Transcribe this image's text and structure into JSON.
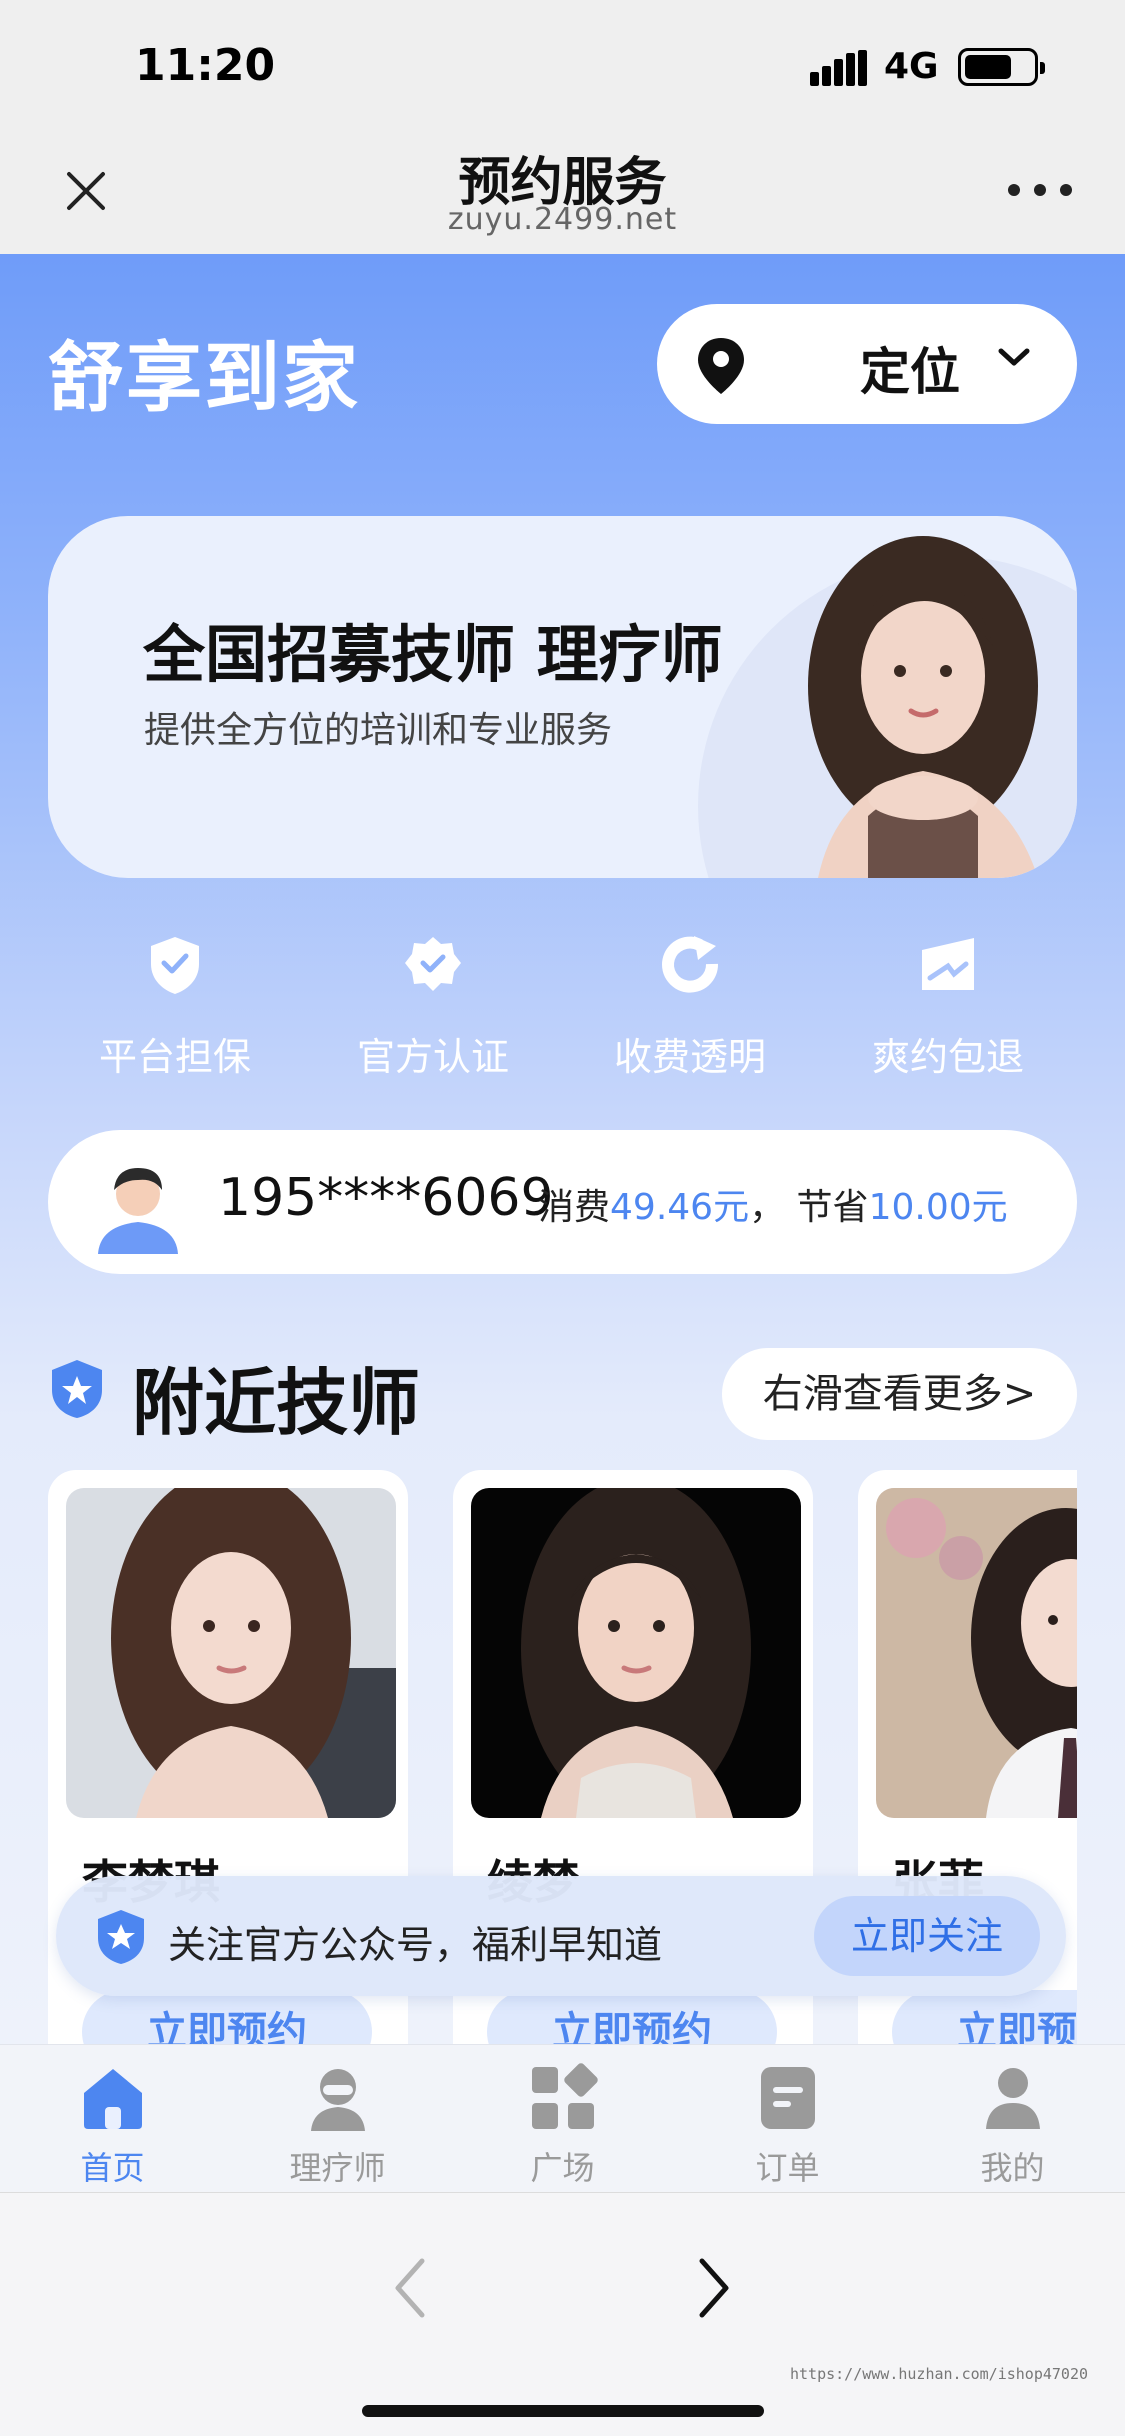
{
  "status_bar": {
    "time": "11:20",
    "network": "4G"
  },
  "browser": {
    "title": "预约服务",
    "url": "zuyu.2499.net"
  },
  "header": {
    "brand": "舒享到家",
    "locate_label": "定位"
  },
  "banner": {
    "title": "全国招募技师 理疗师",
    "subtitle": "提供全方位的培训和专业服务"
  },
  "features": [
    {
      "label": "平台担保",
      "icon": "shield-check-icon"
    },
    {
      "label": "官方认证",
      "icon": "certified-badge-icon"
    },
    {
      "label": "收费透明",
      "icon": "refresh-arrow-icon"
    },
    {
      "label": "爽约包退",
      "icon": "refund-card-icon"
    }
  ],
  "stats": {
    "phone": "195****6069",
    "spend_label": "消费",
    "spend_value": "49.46元",
    "separator": "，",
    "save_label": "节省",
    "save_value": "10.00元"
  },
  "nearby": {
    "title": "附近技师",
    "more": "右滑查看更多>",
    "book_label": "立即预约",
    "techs": [
      {
        "name": "李梦琪"
      },
      {
        "name": "绫梦"
      },
      {
        "name": "张菲"
      }
    ]
  },
  "follow": {
    "text": "关注官方公众号，福利早知道",
    "button": "立即关注"
  },
  "tabs": [
    {
      "label": "首页",
      "icon": "home-icon",
      "active": true
    },
    {
      "label": "理疗师",
      "icon": "therapist-icon",
      "active": false
    },
    {
      "label": "广场",
      "icon": "square-grid-icon",
      "active": false
    },
    {
      "label": "订单",
      "icon": "order-icon",
      "active": false
    },
    {
      "label": "我的",
      "icon": "profile-icon",
      "active": false
    }
  ],
  "watermark": "https://www.huzhan.com/ishop47020",
  "colors": {
    "accent": "#4d86f0",
    "header_gradient_top": "#6f9cf9",
    "tab_inactive": "#9a9a9a"
  }
}
